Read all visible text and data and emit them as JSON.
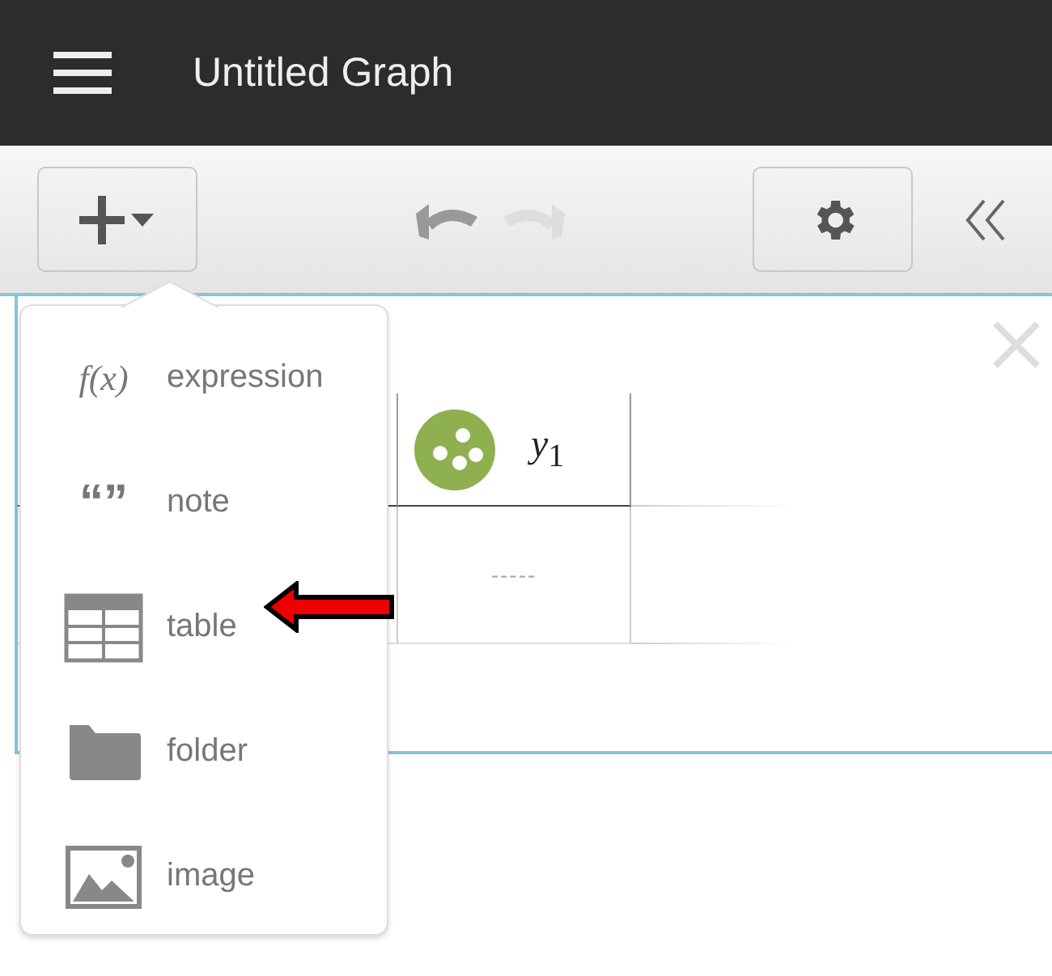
{
  "header": {
    "title": "Untitled Graph"
  },
  "toolbar": {
    "undo": {
      "disabled": false
    },
    "redo": {
      "disabled": true
    }
  },
  "table": {
    "columns": [
      "*y*$_{1}$"
    ],
    "rows": [
      [
        "-----"
      ]
    ]
  },
  "add_menu": {
    "items": [
      {
        "kind": "expression",
        "icon_text": "f(x)",
        "label": "expression"
      },
      {
        "kind": "note",
        "icon_text": "“”",
        "label": "note"
      },
      {
        "kind": "table",
        "label": "table"
      },
      {
        "kind": "folder",
        "label": "folder"
      },
      {
        "kind": "image",
        "label": "image"
      }
    ]
  }
}
